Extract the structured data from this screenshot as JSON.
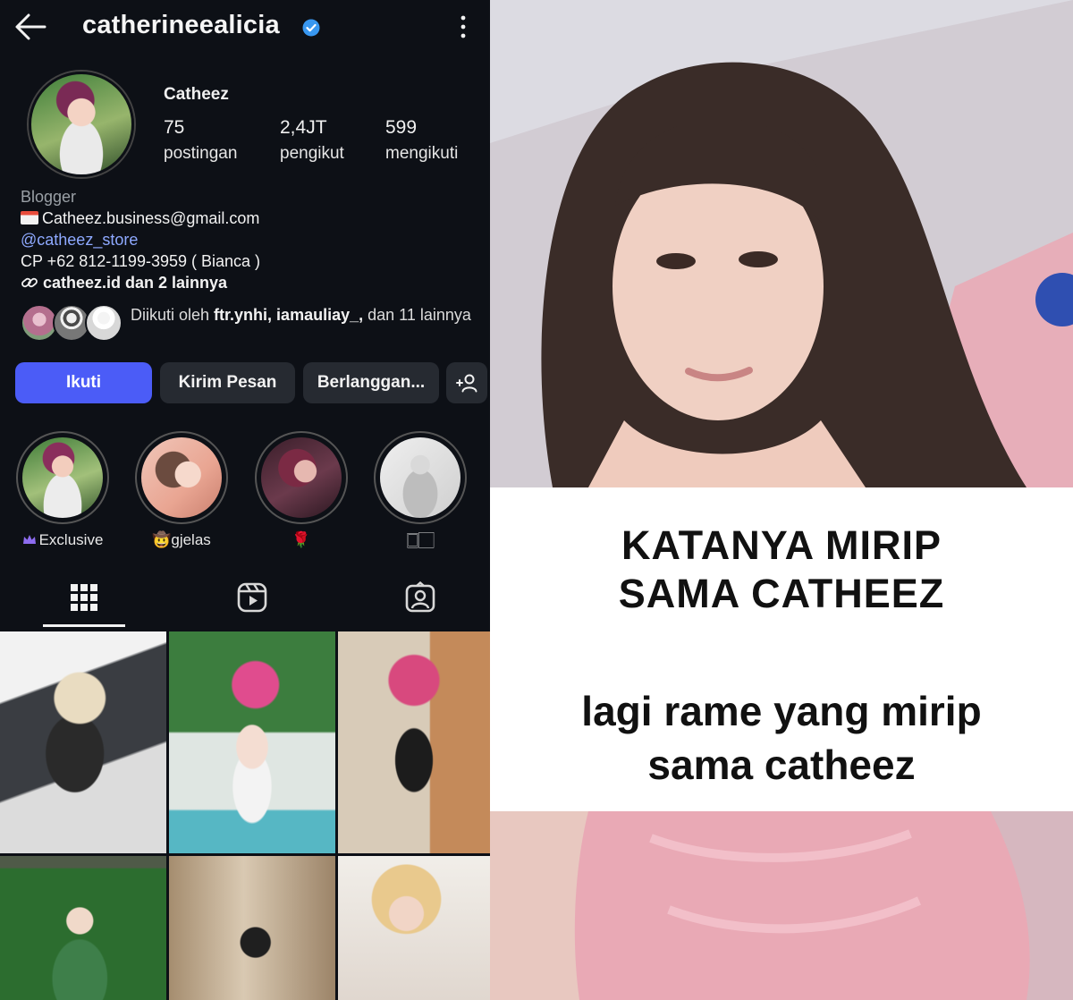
{
  "profile": {
    "username": "catherineealicia",
    "display_name": "Catheez",
    "stats": [
      {
        "value": "75",
        "label": "postingan"
      },
      {
        "value": "2,4JT",
        "label": "pengikut"
      },
      {
        "value": "599",
        "label": "mengikuti"
      }
    ],
    "bio": {
      "category": "Blogger",
      "email": "Catheez.business@gmail.com",
      "mention": "@catheez_store",
      "contact": "CP +62 812-1199-3959 ( Bianca )",
      "links": "catheez.id dan 2 lainnya"
    },
    "followed_by": {
      "prefix": "Diikuti oleh ",
      "names": "ftr.ynhi, iamauliay_,",
      "suffix": " dan 11 lainnya"
    },
    "buttons": {
      "follow": "Ikuti",
      "message": "Kirim Pesan",
      "subscribe": "Berlanggan..."
    },
    "highlights": [
      {
        "label": "Exclusive"
      },
      {
        "label": "🤠gjelas"
      },
      {
        "label": "🌹"
      },
      {
        "label": "🀆🏻"
      }
    ]
  },
  "caption": {
    "headline_line1": "KATANYA MIRIP",
    "headline_line2": "SAMA CATHEEZ",
    "sub_line1": "lagi rame yang mirip",
    "sub_line2": "sama catheez"
  },
  "colors": {
    "background": "#0d1016",
    "primary_button": "#4b5cf7",
    "secondary_button": "#262a31",
    "link": "#8ea9ff",
    "verified": "#3897f0"
  }
}
